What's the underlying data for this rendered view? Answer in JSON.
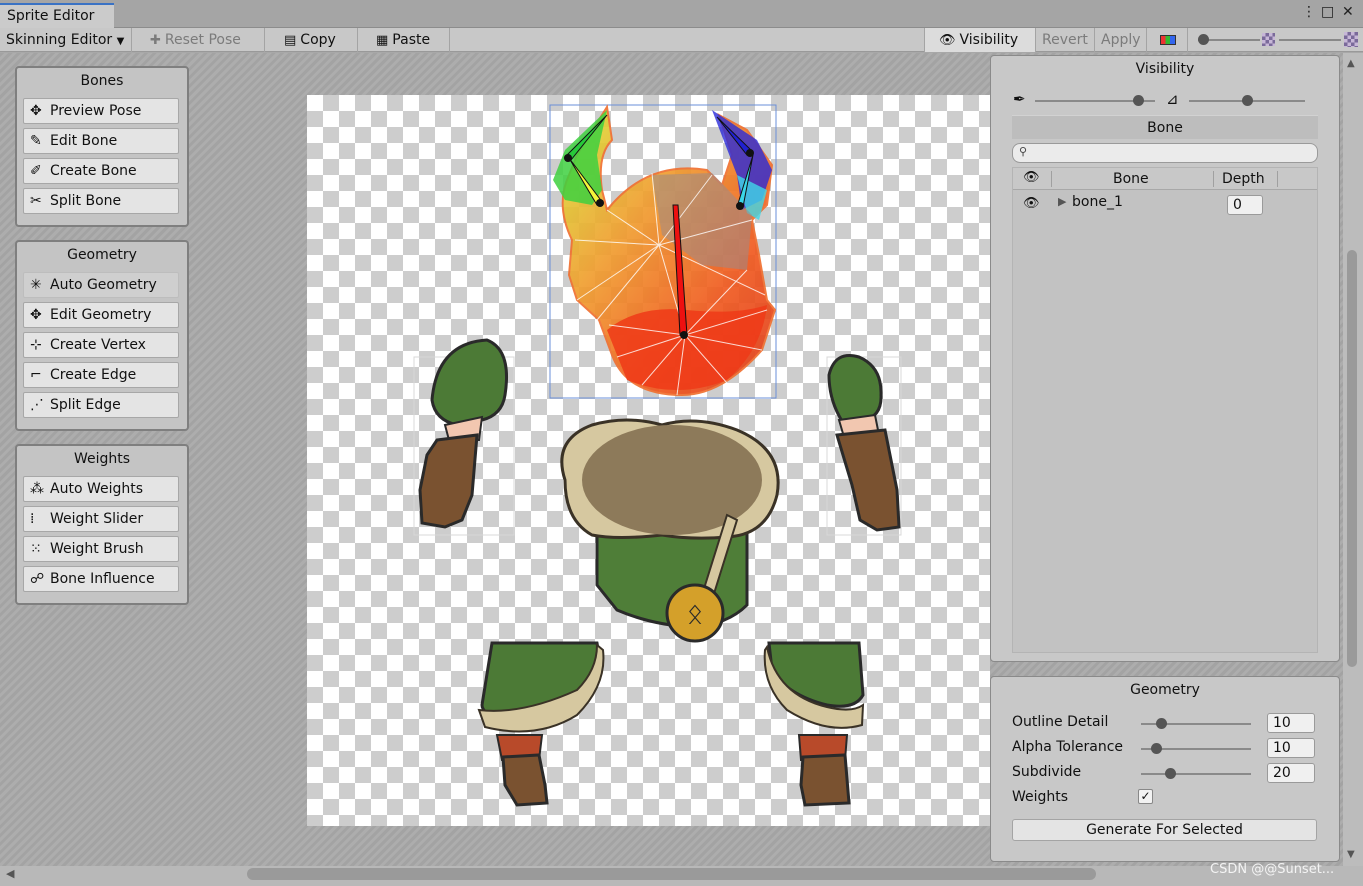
{
  "window": {
    "tab_title": "Sprite Editor",
    "menu_icon": "⋮",
    "maximize_icon": "□",
    "close_icon": "✕"
  },
  "toolbar": {
    "mode_label": "Skinning Editor",
    "reset_pose_label": "Reset Pose",
    "copy_label": "Copy",
    "paste_label": "Paste",
    "visibility_label": "Visibility",
    "revert_label": "Revert",
    "apply_label": "Apply"
  },
  "tools": {
    "bones": {
      "title": "Bones",
      "items": [
        {
          "label": "Preview Pose",
          "icon": "preview-pose-icon"
        },
        {
          "label": "Edit Bone",
          "icon": "edit-bone-icon"
        },
        {
          "label": "Create Bone",
          "icon": "create-bone-icon"
        },
        {
          "label": "Split Bone",
          "icon": "split-bone-icon"
        }
      ]
    },
    "geometry": {
      "title": "Geometry",
      "items": [
        {
          "label": "Auto Geometry",
          "icon": "auto-geometry-icon",
          "active": true
        },
        {
          "label": "Edit Geometry",
          "icon": "edit-geometry-icon"
        },
        {
          "label": "Create Vertex",
          "icon": "create-vertex-icon"
        },
        {
          "label": "Create Edge",
          "icon": "create-edge-icon"
        },
        {
          "label": "Split Edge",
          "icon": "split-edge-icon"
        }
      ]
    },
    "weights": {
      "title": "Weights",
      "items": [
        {
          "label": "Auto Weights",
          "icon": "auto-weights-icon"
        },
        {
          "label": "Weight Slider",
          "icon": "weight-slider-icon"
        },
        {
          "label": "Weight Brush",
          "icon": "weight-brush-icon"
        },
        {
          "label": "Bone Influence",
          "icon": "bone-influence-icon"
        }
      ]
    }
  },
  "visibility_panel": {
    "title": "Visibility",
    "bone_opacity": 0.9,
    "mesh_opacity": 0.5,
    "section_title": "Bone",
    "search_placeholder": "",
    "columns": [
      "Bone",
      "Depth"
    ],
    "rows": [
      {
        "name": "bone_1",
        "depth": "0",
        "visible": true
      }
    ]
  },
  "geometry_panel": {
    "title": "Geometry",
    "outline_detail": {
      "label": "Outline Detail",
      "value": "10",
      "level": 0.15
    },
    "alpha_tolerance": {
      "label": "Alpha Tolerance",
      "value": "10",
      "level": 0.1
    },
    "subdivide": {
      "label": "Subdivide",
      "value": "20",
      "level": 0.24
    },
    "weights": {
      "label": "Weights",
      "checked": true
    },
    "generate_label": "Generate For Selected"
  },
  "watermark": "CSDN @@Sunset..."
}
